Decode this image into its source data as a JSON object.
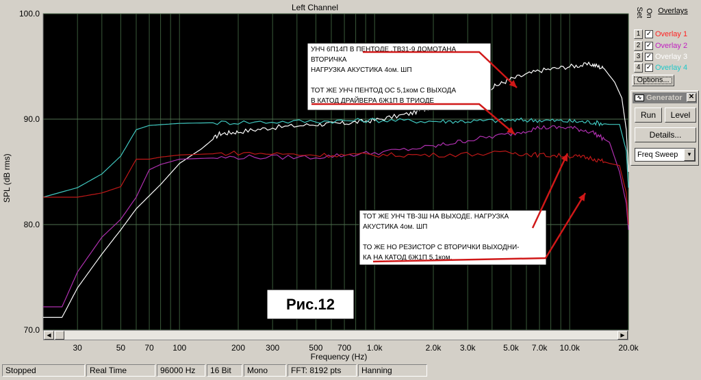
{
  "chart_data": {
    "type": "line",
    "title": "Left Channel",
    "xlabel": "Frequency (Hz)",
    "ylabel": "SPL (dB rms)",
    "xscale": "log",
    "xlim": [
      20,
      20000
    ],
    "ylim": [
      70,
      100
    ],
    "x_ticks": [
      {
        "v": 30,
        "label": "30"
      },
      {
        "v": 50,
        "label": "50"
      },
      {
        "v": 70,
        "label": "70"
      },
      {
        "v": 100,
        "label": "100"
      },
      {
        "v": 200,
        "label": "200"
      },
      {
        "v": 300,
        "label": "300"
      },
      {
        "v": 500,
        "label": "500"
      },
      {
        "v": 700,
        "label": "700"
      },
      {
        "v": 1000,
        "label": "1.0k"
      },
      {
        "v": 2000,
        "label": "2.0k"
      },
      {
        "v": 3000,
        "label": "3.0k"
      },
      {
        "v": 5000,
        "label": "5.0k"
      },
      {
        "v": 7000,
        "label": "7.0k"
      },
      {
        "v": 10000,
        "label": "10.0k"
      },
      {
        "v": 20000,
        "label": "20.0k"
      }
    ],
    "y_ticks": [
      {
        "v": 70,
        "label": "70.0"
      },
      {
        "v": 80,
        "label": "80.0"
      },
      {
        "v": 90,
        "label": "90.0"
      },
      {
        "v": 100,
        "label": "100.0"
      }
    ],
    "grid": true,
    "background": "#000000",
    "series": [
      {
        "color": "#ffffff",
        "points": [
          [
            20,
            71.2
          ],
          [
            25,
            71.2
          ],
          [
            30,
            74
          ],
          [
            40,
            77.2
          ],
          [
            50,
            79.5
          ],
          [
            60,
            81.5
          ],
          [
            80,
            83.8
          ],
          [
            100,
            85.8
          ],
          [
            130,
            87.2
          ],
          [
            160,
            88.6
          ],
          [
            200,
            88.8
          ],
          [
            300,
            89.2
          ],
          [
            500,
            89.5
          ],
          [
            700,
            89.6
          ],
          [
            1000,
            89.9
          ],
          [
            1500,
            90.5
          ],
          [
            2000,
            91.2
          ],
          [
            3000,
            92.2
          ],
          [
            4000,
            93
          ],
          [
            5000,
            93.8
          ],
          [
            7000,
            94.6
          ],
          [
            10000,
            95
          ],
          [
            13000,
            95.2
          ],
          [
            15000,
            94.8
          ],
          [
            17000,
            93.5
          ],
          [
            18500,
            92
          ],
          [
            19500,
            89
          ],
          [
            20000,
            85
          ]
        ]
      },
      {
        "color": "#40c8c0",
        "points": [
          [
            20,
            82.6
          ],
          [
            30,
            83.5
          ],
          [
            40,
            84.8
          ],
          [
            50,
            86.5
          ],
          [
            60,
            89
          ],
          [
            70,
            89.4
          ],
          [
            100,
            89.6
          ],
          [
            200,
            89.7
          ],
          [
            500,
            89.8
          ],
          [
            1000,
            89.9
          ],
          [
            2000,
            89.8
          ],
          [
            3000,
            89.8
          ],
          [
            5000,
            89.9
          ],
          [
            7000,
            89.9
          ],
          [
            10000,
            89.8
          ],
          [
            13000,
            89.7
          ],
          [
            16000,
            89.5
          ],
          [
            18000,
            89.5
          ],
          [
            19500,
            87
          ],
          [
            20000,
            83.5
          ]
        ]
      },
      {
        "color": "#b030b0",
        "points": [
          [
            20,
            72.2
          ],
          [
            25,
            72.2
          ],
          [
            30,
            75.5
          ],
          [
            40,
            78.8
          ],
          [
            50,
            80.5
          ],
          [
            60,
            82.6
          ],
          [
            70,
            85.2
          ],
          [
            80,
            85.7
          ],
          [
            100,
            86.2
          ],
          [
            200,
            86.4
          ],
          [
            500,
            86.4
          ],
          [
            1000,
            86.8
          ],
          [
            2000,
            87.4
          ],
          [
            3000,
            88
          ],
          [
            5000,
            88.6
          ],
          [
            7000,
            89.2
          ],
          [
            10000,
            89.2
          ],
          [
            13000,
            88.8
          ],
          [
            16000,
            87.8
          ],
          [
            18000,
            85
          ],
          [
            19500,
            82
          ],
          [
            20000,
            79.5
          ]
        ]
      },
      {
        "color": "#c01818",
        "points": [
          [
            20,
            82.6
          ],
          [
            30,
            82.6
          ],
          [
            40,
            83
          ],
          [
            50,
            83.6
          ],
          [
            60,
            86.2
          ],
          [
            70,
            86.2
          ],
          [
            80,
            86.4
          ],
          [
            100,
            86.6
          ],
          [
            200,
            86.8
          ],
          [
            500,
            86.6
          ],
          [
            1000,
            86.6
          ],
          [
            2000,
            86.6
          ],
          [
            5000,
            86.8
          ],
          [
            7000,
            86.6
          ],
          [
            10000,
            86.5
          ],
          [
            13000,
            86.3
          ],
          [
            16000,
            85.8
          ],
          [
            18000,
            85.6
          ],
          [
            19500,
            83
          ],
          [
            20000,
            80
          ]
        ]
      }
    ],
    "annotations": [
      {
        "lines": [
          "УНЧ 6П14П  В ПЕНТОДЕ ,ТВ31-9 ДОМОТАНА",
          "ВТОРИЧКА",
          "НАГРУЗКА  АКУСТИКА 4ом. ШП",
          "",
          "ТОТ ЖЕ УНЧ ПЕНТОД  ОС 5,1ком С ВЫХОДА",
          "В КАТОД ДРАЙВЕРА 6Ж1П В ТРИОДЕ"
        ]
      },
      {
        "lines": [
          "ТОТ ЖЕ УНЧ ТВ-3Ш НА ВЫХОДЕ. НАГРУЗКА",
          "АКУСТИКА 4ом. ШП",
          "",
          "ТО ЖЕ НО РЕЗИСТОР С ВТОРИЧКИ ВЫХОДНИ-",
          "КА НА КАТОД 6Ж1П  5.1ком."
        ]
      },
      {
        "lines": [
          "Рис.12"
        ]
      }
    ]
  },
  "overlays": {
    "title": "Overlays",
    "set_label": "Set",
    "on_label": "On",
    "check_mark": "✓",
    "items": [
      {
        "num": "1",
        "name": "Overlay 1",
        "color": "#ff2020"
      },
      {
        "num": "2",
        "name": "Overlay 2",
        "color": "#c020c0"
      },
      {
        "num": "3",
        "name": "Overlay 3",
        "color": "#ffffff"
      },
      {
        "num": "4",
        "name": "Overlay 4",
        "color": "#20c8c8"
      }
    ],
    "options_label": "Options..."
  },
  "generator": {
    "title": "Generator",
    "run_label": "Run",
    "level_label": "Level",
    "details_label": "Details...",
    "sweep_value": "Freq Sweep"
  },
  "status": {
    "state": "Stopped",
    "mode": "Real Time",
    "rate": "96000 Hz",
    "bits": "16 Bit",
    "channels": "Mono",
    "fft": "FFT: 8192 pts",
    "window": "Hanning"
  }
}
